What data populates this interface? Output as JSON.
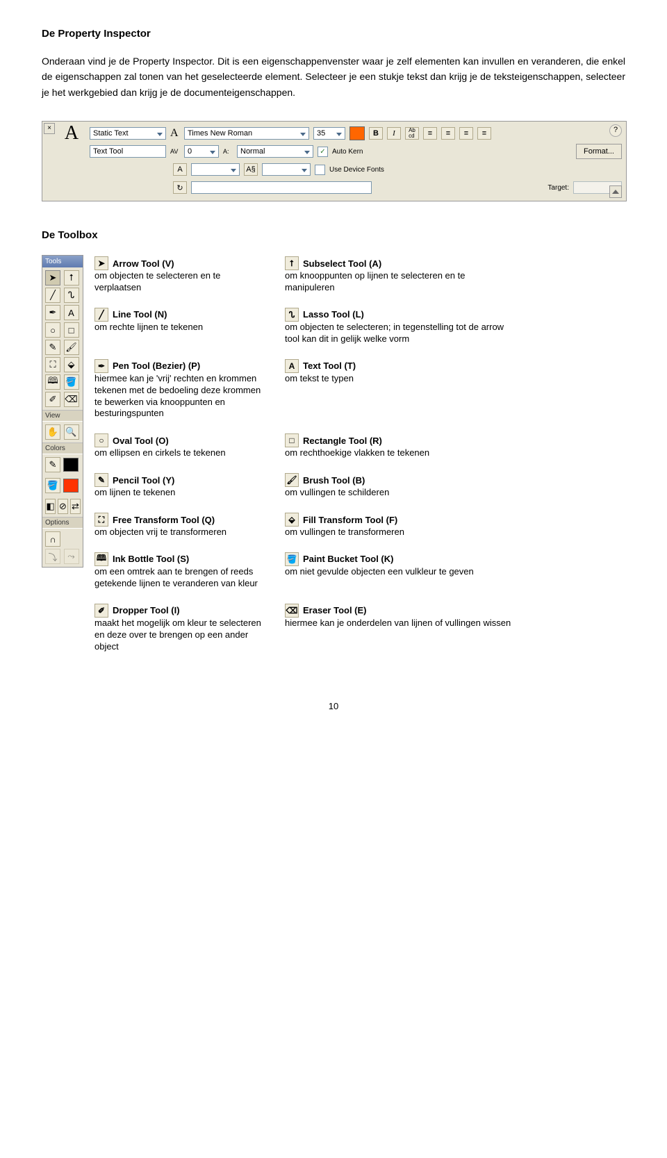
{
  "heading1": "De Property Inspector",
  "para1": "Onderaan vind je de Property Inspector. Dit is een eigenschappenvenster waar je zelf elementen kan invullen en veranderen, die enkel de eigenschappen zal tonen van het geselecteerde element. Selecteer je een stukje tekst dan krijg je de teksteigenschappen, selecteer je het werkgebied dan krijg je de documenteigenschappen.",
  "pi": {
    "close": "×",
    "typeLabel": "A",
    "textType": "Static Text",
    "instance": "Text Tool",
    "fontLabel": "A",
    "font": "Times New Roman",
    "sizeLabel": "",
    "size": "35",
    "color": "#ff6600",
    "bold": "B",
    "italic": "I",
    "abcd": "Ab\ncd",
    "al1": "≡",
    "al2": "≡",
    "al3": "≡",
    "al4": "≡",
    "help": "?",
    "avLabel": "AV",
    "av": "0",
    "aaLabel": "A:",
    "aa": "Normal",
    "autoKern": "Auto Kern",
    "check": "✓",
    "format": "Format...",
    "row3a": "A",
    "row3aVal": "",
    "row3b": "A§",
    "row3bVal": "",
    "useDeviceFonts": "Use Device Fonts",
    "row4a": "↻",
    "row4Val": "",
    "target": "Target:"
  },
  "heading2": "De Toolbox",
  "toolspanel": {
    "title": "Tools",
    "view": "View",
    "colors": "Colors",
    "options": "Options"
  },
  "tools": [
    {
      "left": {
        "icon": "➤",
        "name": "Arrow Tool (V)",
        "desc": "om objecten te selecteren en te verplaatsen"
      },
      "right": {
        "icon": "⭡",
        "name": "Subselect Tool (A)",
        "desc": "om knooppunten op lijnen te selecteren en te manipuleren"
      }
    },
    {
      "left": {
        "icon": "╱",
        "name": "Line Tool (N)",
        "desc": "om rechte lijnen te tekenen"
      },
      "right": {
        "icon": "ᔐ",
        "name": "Lasso Tool (L)",
        "desc": "om objecten te selecteren; in tegenstelling tot de arrow tool kan dit in gelijk welke vorm"
      }
    },
    {
      "left": {
        "icon": "✒",
        "name": "Pen Tool (Bezier) (P)",
        "desc": "hiermee kan je 'vrij' rechten en krommen tekenen met de bedoeling deze krommen te bewerken via knooppunten en besturingspunten"
      },
      "right": {
        "icon": "A",
        "name": "Text Tool (T)",
        "desc": "om tekst te typen"
      }
    },
    {
      "left": {
        "icon": "○",
        "name": "Oval Tool (O)",
        "desc": "om ellipsen en cirkels te tekenen"
      },
      "right": {
        "icon": "□",
        "name": "Rectangle Tool (R)",
        "desc": "om rechthoekige vlakken te tekenen"
      }
    },
    {
      "left": {
        "icon": "✎",
        "name": "Pencil Tool (Y)",
        "desc": "om lijnen te tekenen"
      },
      "right": {
        "icon": "🖌",
        "name": "Brush Tool (B)",
        "desc": "om vullingen te schilderen"
      }
    },
    {
      "left": {
        "icon": "⛶",
        "name": "Free Transform Tool (Q)",
        "desc": "om objecten vrij te transformeren"
      },
      "right": {
        "icon": "⬙",
        "name": "Fill Transform Tool (F)",
        "desc": "om vullingen te transformeren"
      }
    },
    {
      "left": {
        "icon": "🕮",
        "name": "Ink Bottle Tool (S)",
        "desc": "om een omtrek aan te brengen of reeds getekende lijnen te veranderen van kleur"
      },
      "right": {
        "icon": "🪣",
        "name": "Paint Bucket Tool (K)",
        "desc": "om niet gevulde objecten een vulkleur te geven"
      }
    },
    {
      "left": {
        "icon": "✐",
        "name": "Dropper Tool (I)",
        "desc": "maakt het mogelijk om kleur te selecteren en deze over te brengen op een ander object"
      },
      "right": {
        "icon": "⌫",
        "name": "Eraser Tool (E)",
        "desc": "hiermee kan je onderdelen van lijnen of vullingen wissen"
      }
    }
  ],
  "pagenum": "10"
}
